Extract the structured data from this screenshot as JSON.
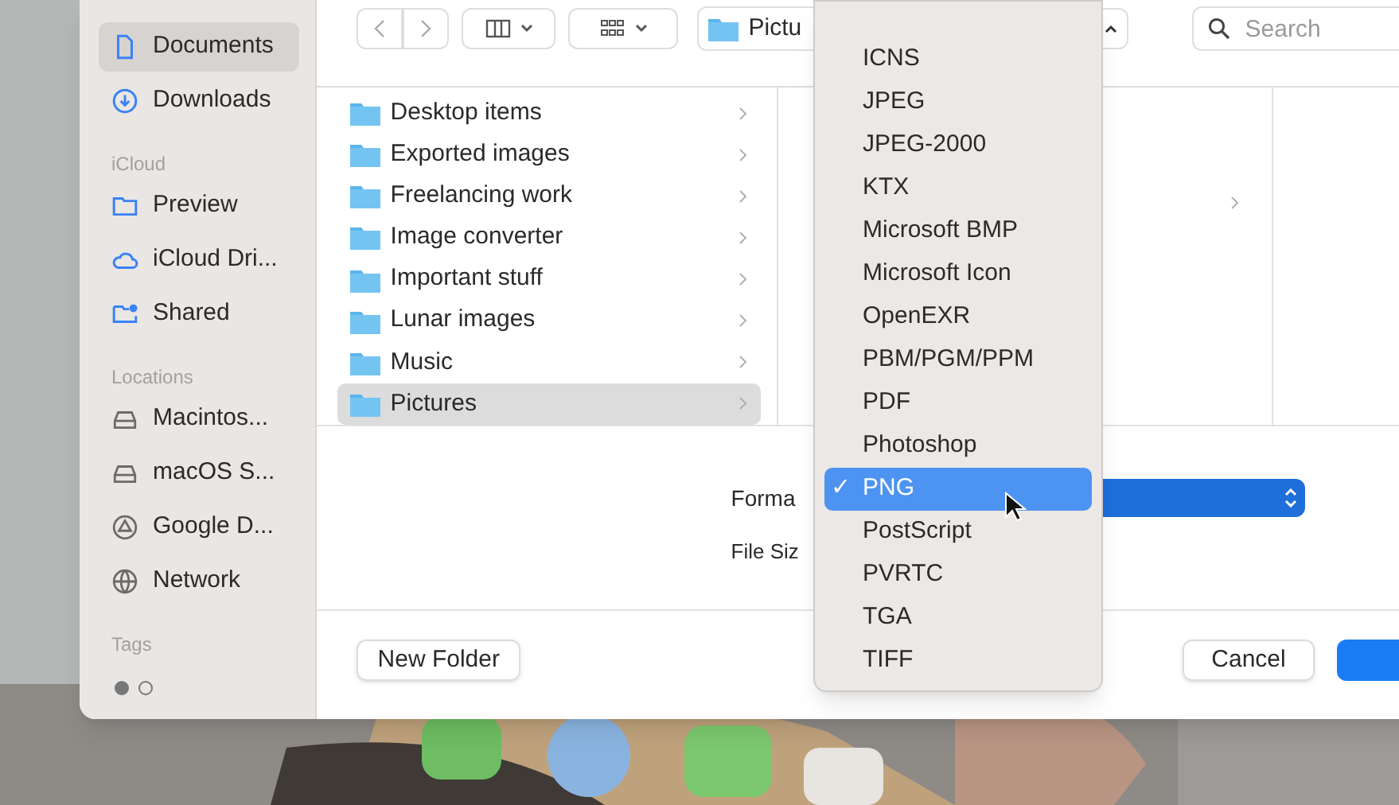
{
  "sidebar": {
    "sections": [
      {
        "items": [
          {
            "label": "Documents",
            "kind": "document",
            "selected": true
          },
          {
            "label": "Downloads",
            "kind": "download",
            "selected": false
          }
        ]
      },
      {
        "header": "iCloud",
        "items": [
          {
            "label": "Preview",
            "kind": "folder",
            "selected": false
          },
          {
            "label": "iCloud Dri...",
            "kind": "cloud",
            "selected": false
          },
          {
            "label": "Shared",
            "kind": "shared",
            "selected": false
          }
        ]
      },
      {
        "header": "Locations",
        "items": [
          {
            "label": "Macintos...",
            "kind": "disk",
            "selected": false
          },
          {
            "label": "macOS S...",
            "kind": "disk",
            "selected": false
          },
          {
            "label": "Google D...",
            "kind": "drive",
            "selected": false
          },
          {
            "label": "Network",
            "kind": "globe",
            "selected": false
          }
        ]
      },
      {
        "header": "Tags"
      }
    ]
  },
  "toolbar": {
    "path": "Pictu",
    "search": {
      "placeholder": "Search"
    }
  },
  "columns": [
    {
      "items": [
        {
          "label": "Desktop items",
          "selected": false
        },
        {
          "label": "Exported images",
          "selected": false
        },
        {
          "label": "Freelancing work",
          "selected": false
        },
        {
          "label": "Image converter",
          "selected": false
        },
        {
          "label": "Important stuff",
          "selected": false
        },
        {
          "label": "Lunar images",
          "selected": false
        },
        {
          "label": "Music",
          "selected": false
        },
        {
          "label": "Pictures",
          "selected": true
        }
      ]
    }
  ],
  "options": {
    "format_label": "Forma",
    "file_size_label": "File Siz"
  },
  "buttons": {
    "new_folder": "New Folder",
    "cancel": "Cancel"
  },
  "format_menu": [
    {
      "label": "ICNS",
      "selected": false
    },
    {
      "label": "JPEG",
      "selected": false
    },
    {
      "label": "JPEG-2000",
      "selected": false
    },
    {
      "label": "KTX",
      "selected": false
    },
    {
      "label": "Microsoft BMP",
      "selected": false
    },
    {
      "label": "Microsoft Icon",
      "selected": false
    },
    {
      "label": "OpenEXR",
      "selected": false
    },
    {
      "label": "PBM/PGM/PPM",
      "selected": false
    },
    {
      "label": "PDF",
      "selected": false
    },
    {
      "label": "Photoshop",
      "selected": false
    },
    {
      "label": "PNG",
      "selected": true
    },
    {
      "label": "PostScript",
      "selected": false
    },
    {
      "label": "PVRTC",
      "selected": false
    },
    {
      "label": "TGA",
      "selected": false
    },
    {
      "label": "TIFF",
      "selected": false
    }
  ],
  "check_mark": "✓"
}
